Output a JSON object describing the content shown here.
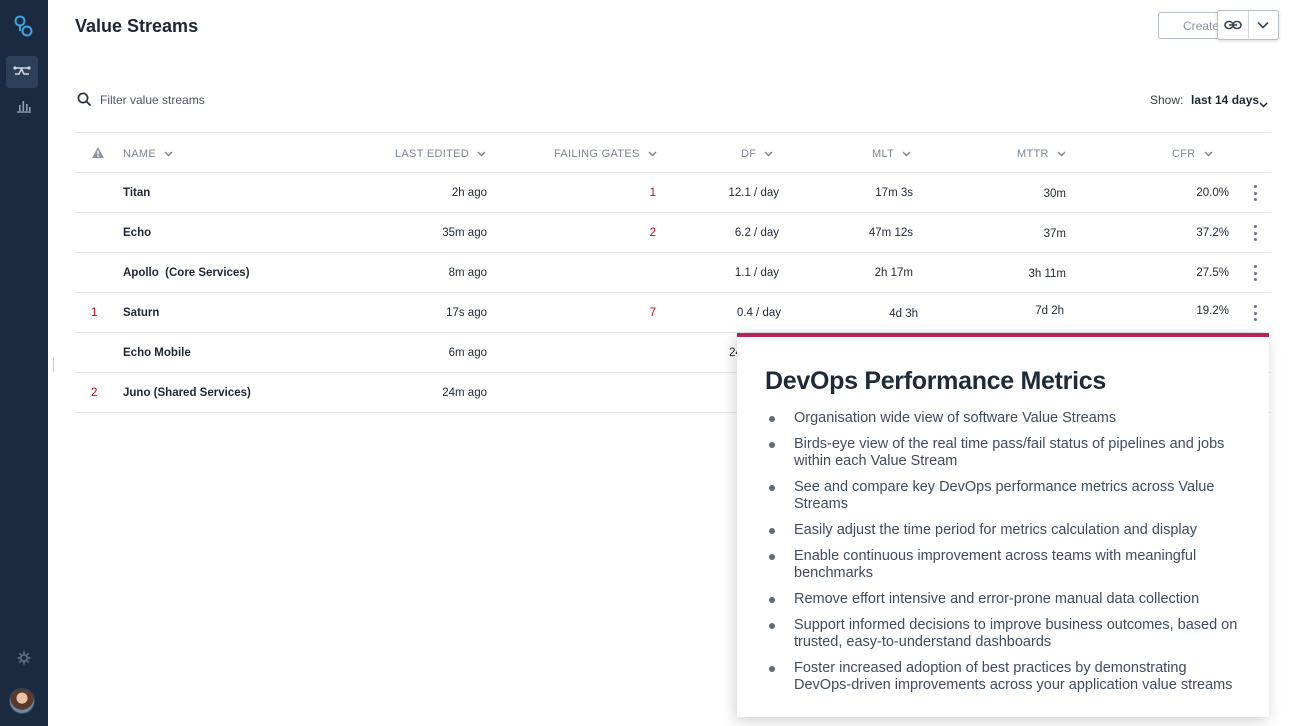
{
  "header": {
    "title": "Value Streams",
    "create_label": "Create"
  },
  "filter": {
    "placeholder": "Filter value streams",
    "show_label": "Show:",
    "show_value": "last 14 days"
  },
  "table": {
    "columns": {
      "name": "NAME",
      "last_edited": "LAST EDITED",
      "failing_gates": "FAILING GATES",
      "df": "DF",
      "mlt": "MLT",
      "mttr": "MTTR",
      "cfr": "CFR"
    },
    "rows": [
      {
        "alert": "",
        "name": "Titan",
        "last_edited": "2h ago",
        "failing_gates": "1",
        "df": "12.1 / day",
        "mlt": "17m 3s",
        "mttr": "30m",
        "cfr": "20.0%"
      },
      {
        "alert": "",
        "name": "Echo",
        "last_edited": "35m ago",
        "failing_gates": "2",
        "df": "6.2 / day",
        "mlt": "47m 12s",
        "mttr": "37m",
        "cfr": "37.2%"
      },
      {
        "alert": "",
        "name": "Apollo  (Core Services)",
        "last_edited": "8m ago",
        "failing_gates": "",
        "df": "1.1 / day",
        "mlt": "2h 17m",
        "mttr": "3h 11m",
        "cfr": "27.5%"
      },
      {
        "alert": "1",
        "name": "Saturn",
        "last_edited": "17s ago",
        "failing_gates": "7",
        "df": "0.4 / day",
        "mlt": "4d 3h",
        "mttr": "7d 2h",
        "cfr": "19.2%"
      },
      {
        "alert": "",
        "name": "Echo Mobile",
        "last_edited": "6m ago",
        "failing_gates": "",
        "df": "24",
        "mlt": "",
        "mttr": "",
        "cfr": ""
      },
      {
        "alert": "2",
        "name": "Juno (Shared Services)",
        "last_edited": "24m ago",
        "failing_gates": "",
        "df": "",
        "mlt": "",
        "mttr": "",
        "cfr": ""
      }
    ]
  },
  "panel": {
    "title": "DevOps Performance Metrics",
    "accent_color": "#b8235a",
    "items": [
      "Organisation wide view of software Value Streams",
      "Birds-eye view of the real time pass/fail status of pipelines and jobs within each Value Stream",
      "See and compare key DevOps performance metrics across Value Streams",
      "Easily adjust the time period for metrics calculation and display",
      "Enable continuous improvement across teams with meaningful benchmarks",
      "Remove effort intensive and error-prone manual data collection",
      "Support informed decisions to improve business outcomes, based on trusted, easy-to-understand dashboards",
      "Foster increased adoption of best practices by demonstrating DevOps-driven improvements across your application value streams"
    ]
  },
  "colors": {
    "sidebar": "#1b2a40",
    "alert_red": "#d0021b",
    "logo_blue": "#3fa6e0"
  }
}
